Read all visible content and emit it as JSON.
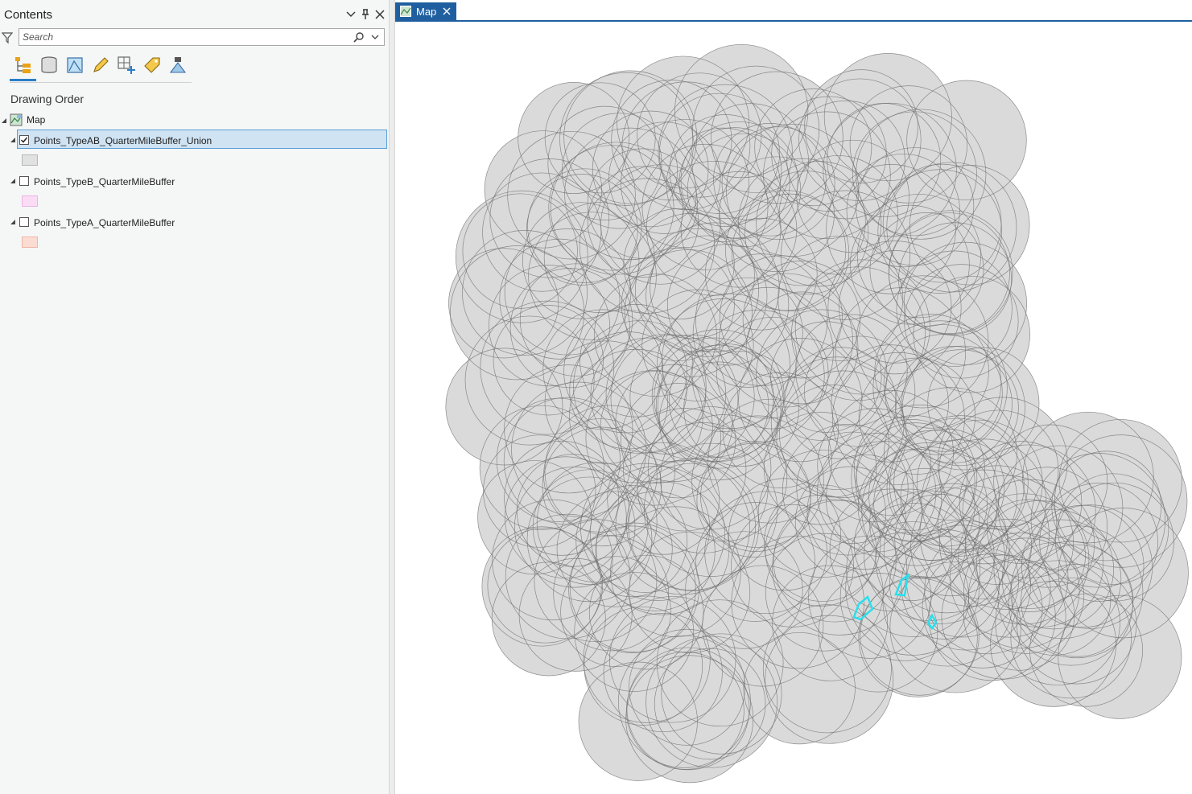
{
  "contents_pane": {
    "title": "Contents",
    "search_placeholder": "Search",
    "section_label": "Drawing Order",
    "map_node": "Map",
    "layers": [
      {
        "name": "Points_TypeAB_QuarterMileBuffer_Union",
        "checked": true,
        "swatch": "#e1e1e1",
        "swatch_border": "#b8b8b8"
      },
      {
        "name": "Points_TypeB_QuarterMileBuffer",
        "checked": false,
        "swatch": "#fbdcf5",
        "swatch_border": "#ecb4e4"
      },
      {
        "name": "Points_TypeA_QuarterMileBuffer",
        "checked": false,
        "swatch": "#fbdcd3",
        "swatch_border": "#f0b6a6"
      }
    ],
    "toolbar_icons": [
      "list-by-drawing-order-icon",
      "list-by-source-icon",
      "list-by-selection-icon",
      "list-by-editing-icon",
      "list-by-snapping-icon",
      "list-by-labeling-icon",
      "list-by-perspective-imagery-icon"
    ]
  },
  "map_view": {
    "tab_label": "Map",
    "colors": {
      "buffer_fill": "#dadada",
      "buffer_stroke": "#6e6e6e",
      "highlight": "#28e1ee",
      "tab_blue": "#1f5fa0"
    }
  }
}
